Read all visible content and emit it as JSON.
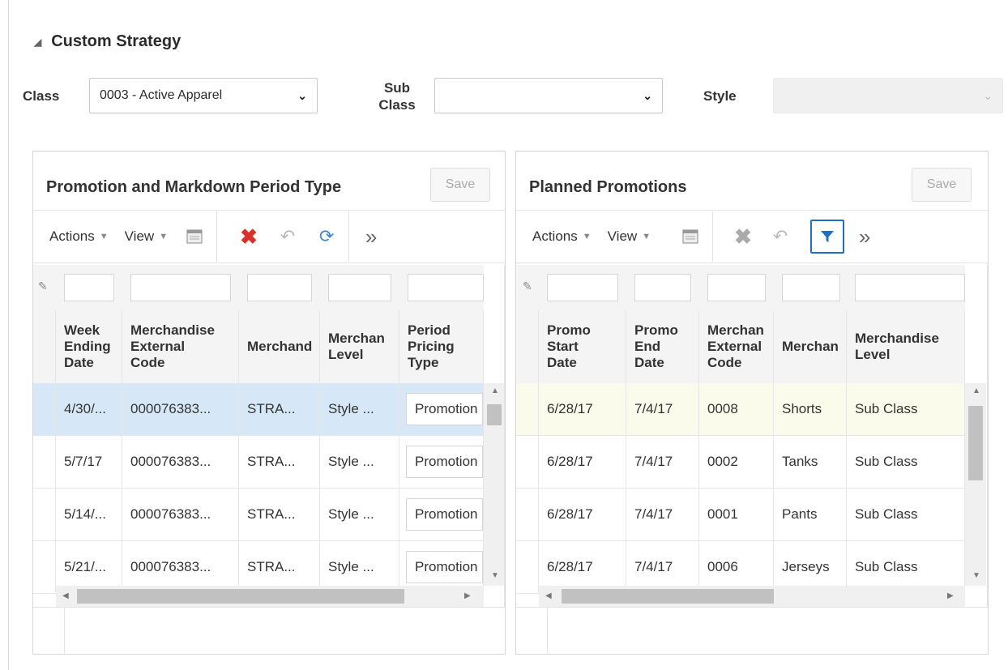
{
  "section": {
    "title": "Custom Strategy"
  },
  "filters": {
    "class_label": "Class",
    "class_value": "0003 - Active Apparel",
    "subclass_label_1": "Sub",
    "subclass_label_2": "Class",
    "subclass_value": "",
    "style_label": "Style",
    "style_value": ""
  },
  "left_panel": {
    "title": "Promotion and Markdown Period Type",
    "save_label": "Save",
    "toolbar": {
      "actions": "Actions",
      "view": "View",
      "overflow": "»"
    },
    "columns": [
      {
        "l1": "Week",
        "l2": "Ending",
        "l3": "Date"
      },
      {
        "l1": "Merchandise",
        "l2": "External",
        "l3": "Code"
      },
      {
        "l1": "Merchand",
        "l2": "",
        "l3": ""
      },
      {
        "l1": "Merchan",
        "l2": "Level",
        "l3": ""
      },
      {
        "l1": "Period",
        "l2": "Pricing",
        "l3": "Type"
      }
    ],
    "rows": [
      [
        "4/30/...",
        "000076383...",
        "STRA...",
        "Style ...",
        "Promotion"
      ],
      [
        "5/7/17",
        "000076383...",
        "STRA...",
        "Style ...",
        "Promotion"
      ],
      [
        "5/14/...",
        "000076383...",
        "STRA...",
        "Style ...",
        "Promotion"
      ],
      [
        "5/21/...",
        "000076383...",
        "STRA...",
        "Style ...",
        "Promotion"
      ]
    ]
  },
  "right_panel": {
    "title": "Planned Promotions",
    "save_label": "Save",
    "toolbar": {
      "actions": "Actions",
      "view": "View",
      "overflow": "»"
    },
    "columns": [
      {
        "l1": "Promo",
        "l2": "Start",
        "l3": "Date"
      },
      {
        "l1": "Promo",
        "l2": "End",
        "l3": "Date"
      },
      {
        "l1": "Merchan",
        "l2": "External",
        "l3": "Code"
      },
      {
        "l1": "Merchan",
        "l2": "",
        "l3": ""
      },
      {
        "l1": "Merchandise",
        "l2": "Level",
        "l3": ""
      }
    ],
    "rows": [
      [
        "6/28/17",
        "7/4/17",
        "0008",
        "Shorts",
        "Sub Class"
      ],
      [
        "6/28/17",
        "7/4/17",
        "0002",
        "Tanks",
        "Sub Class"
      ],
      [
        "6/28/17",
        "7/4/17",
        "0001",
        "Pants",
        "Sub Class"
      ],
      [
        "6/28/17",
        "7/4/17",
        "0006",
        "Jerseys",
        "Sub Class"
      ]
    ]
  },
  "colors": {
    "selected_row": "#d6e8f8",
    "highlight_row": "#fafbea",
    "delete_icon": "#d9302a",
    "refresh_icon": "#3a89c9",
    "filter_icon": "#1f6fc0"
  },
  "icons": [
    "collapse-triangle-icon",
    "chevron-down-icon",
    "detach-icon",
    "delete-icon",
    "undo-icon",
    "refresh-icon",
    "filter-icon",
    "more-icon"
  ]
}
